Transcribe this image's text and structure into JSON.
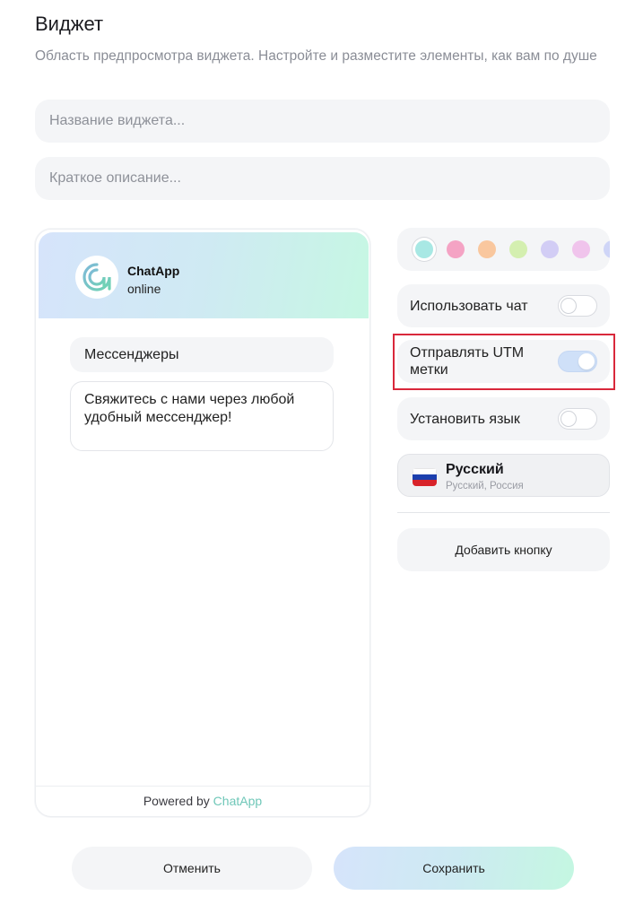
{
  "header": {
    "title": "Виджет",
    "subtitle": "Область предпросмотра виджета. Настройте и разместите элементы, как вам по душе"
  },
  "form": {
    "name_placeholder": "Название виджета...",
    "description_placeholder": "Краткое описание..."
  },
  "preview": {
    "brand_name": "ChatApp",
    "brand_status": "online",
    "section_title": "Мессенджеры",
    "message": "Свяжитесь с нами через любой удобный мессенджер!",
    "footer_prefix": "Powered by",
    "footer_brand": "ChatApp"
  },
  "colors": {
    "selected_index": 0,
    "swatches": [
      "#a8e8e4",
      "#f4a3c4",
      "#f9c79e",
      "#d4efb0",
      "#d2cdf5",
      "#f0c4ec",
      "#cfd5f7"
    ]
  },
  "settings": {
    "use_chat": {
      "label": "Использовать чат",
      "enabled": false
    },
    "send_utm": {
      "label": "Отправлять UTM метки",
      "enabled": true
    },
    "set_language": {
      "label": "Установить язык",
      "enabled": false
    }
  },
  "language": {
    "name": "Русский",
    "subtitle": "Русский, Россия",
    "flag_icon": "russia-flag-icon"
  },
  "actions": {
    "add_button": "Добавить кнопку",
    "cancel": "Отменить",
    "save": "Сохранить"
  },
  "theme": {
    "accent_gradient_start": "#d6e4fb",
    "accent_gradient_end": "#c4f7e1",
    "highlight_color": "#d9283b",
    "brand_color": "#6fc7b8"
  }
}
